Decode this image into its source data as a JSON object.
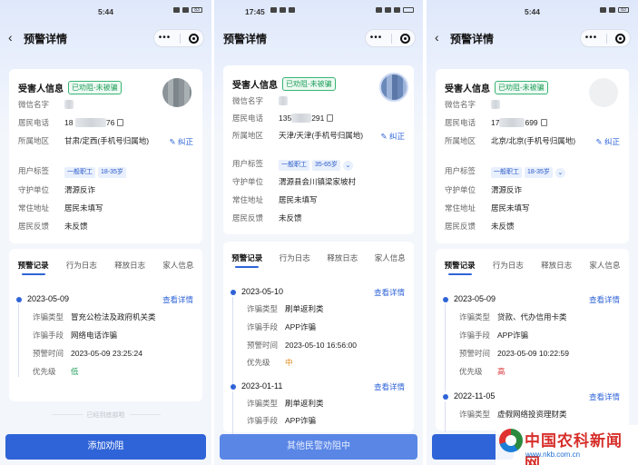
{
  "screens": [
    {
      "status_time": "5:44",
      "nav_title": "预警详情",
      "info_title": "受害人信息",
      "status_badge": "已劝阻-未被骗",
      "fields": {
        "wechat_label": "微信名字",
        "phone_label": "居民电话",
        "phone_prefix": "18",
        "phone_suffix": "76",
        "region_label": "所属地区",
        "region_value": "甘肃/定西(手机号归属地)",
        "tag_label": "用户标签",
        "tags": [
          "一般职工",
          "18-35岁"
        ],
        "guard_label": "守护单位",
        "guard_value": "渭源反诈",
        "address_label": "常住地址",
        "address_value": "居民未填写",
        "feedback_label": "居民反馈",
        "feedback_value": "未反馈"
      },
      "correct_label": "纠正",
      "tabs": [
        "预警记录",
        "行为日志",
        "释放日志",
        "家人信息"
      ],
      "records": [
        {
          "date": "2023-05-09",
          "detail_label": "查看详情",
          "type_label": "诈骗类型",
          "type_value": "冒充公检法及政府机关类",
          "method_label": "诈骗手段",
          "method_value": "网络电话诈骗",
          "time_label": "预警时间",
          "time_value": "2023-05-09 23:25:24",
          "priority_label": "优先级",
          "priority_value": "低"
        }
      ],
      "no_more": "已经到底部啦",
      "button_label": "添加劝阻"
    },
    {
      "status_time": "17:45",
      "nav_title": "预警详情",
      "info_title": "受害人信息",
      "status_badge": "已劝阻-未被骗",
      "fields": {
        "wechat_label": "微信名字",
        "phone_label": "居民电话",
        "phone_prefix": "135",
        "phone_suffix": "291",
        "region_label": "所属地区",
        "region_value": "天津/天津(手机号归属地)",
        "tag_label": "用户标签",
        "tags": [
          "一般职工",
          "35-65岁"
        ],
        "guard_label": "守护单位",
        "guard_value": "渭源县会川镇梁家坡村",
        "address_label": "常住地址",
        "address_value": "居民未填写",
        "feedback_label": "居民反馈",
        "feedback_value": "未反馈"
      },
      "correct_label": "纠正",
      "tabs": [
        "预警记录",
        "行为日志",
        "释放日志",
        "家人信息"
      ],
      "records": [
        {
          "date": "2023-05-10",
          "detail_label": "查看详情",
          "type_label": "诈骗类型",
          "type_value": "刷单返利类",
          "method_label": "诈骗手段",
          "method_value": "APP诈骗",
          "time_label": "预警时间",
          "time_value": "2023-05-10 16:56:00",
          "priority_label": "优先级",
          "priority_value": "中"
        },
        {
          "date": "2023-01-11",
          "detail_label": "查看详情",
          "type_label": "诈骗类型",
          "type_value": "刷单返利类",
          "method_label": "诈骗手段",
          "method_value": "APP诈骗"
        }
      ],
      "button_label": "其他民警劝阻中"
    },
    {
      "status_time": "5:44",
      "nav_title": "预警详情",
      "info_title": "受害人信息",
      "status_badge": "已劝阻-未被骗",
      "fields": {
        "wechat_label": "微信名字",
        "phone_label": "居民电话",
        "phone_prefix": "17",
        "phone_suffix": "699",
        "region_label": "所属地区",
        "region_value": "北京/北京(手机号归属地)",
        "tag_label": "用户标签",
        "tags": [
          "一般职工",
          "18-35岁"
        ],
        "guard_label": "守护单位",
        "guard_value": "渭源反诈",
        "address_label": "常住地址",
        "address_value": "居民未填写",
        "feedback_label": "居民反馈",
        "feedback_value": "未反馈"
      },
      "correct_label": "纠正",
      "tabs": [
        "预警记录",
        "行为日志",
        "释放日志",
        "家人信息"
      ],
      "records": [
        {
          "date": "2023-05-09",
          "detail_label": "查看详情",
          "type_label": "诈骗类型",
          "type_value": "贷款、代办信用卡类",
          "method_label": "诈骗手段",
          "method_value": "APP诈骗",
          "time_label": "预警时间",
          "time_value": "2023-05-09 10:22:59",
          "priority_label": "优先级",
          "priority_value": "高"
        },
        {
          "date": "2022-11-05",
          "detail_label": "查看详情",
          "type_label": "诈骗类型",
          "type_value": "虚假网络投资理财类"
        }
      ]
    }
  ],
  "watermark": {
    "brand": "中国农科新闻网",
    "url": "www.nkb.com.cn"
  },
  "colors": {
    "accent": "#2f64d8",
    "badge_green": "#1e9e5a",
    "priority_low": "#1e9e5a",
    "priority_mid": "#e08a1a",
    "priority_high": "#d93838"
  },
  "icons": [
    "back-arrow-icon",
    "more-dots-icon",
    "target-icon",
    "copy-icon",
    "edit-pen-icon",
    "chevron-down-icon"
  ]
}
